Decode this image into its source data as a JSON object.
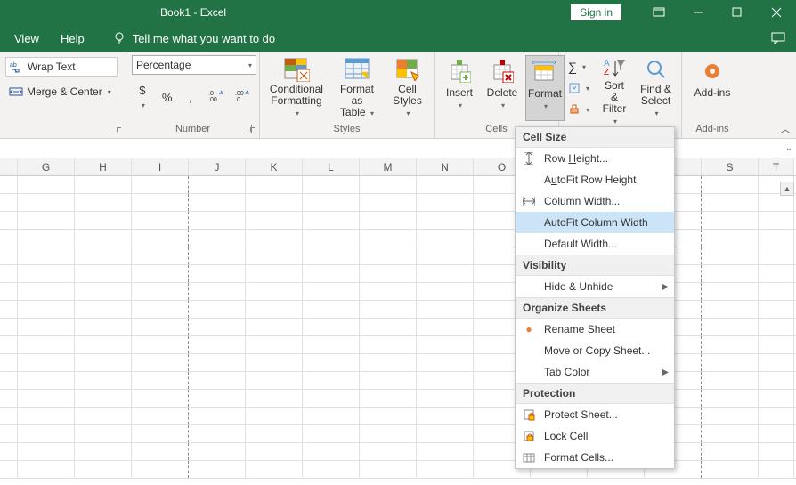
{
  "title": "Book1  -  Excel",
  "signin": "Sign in",
  "menu": {
    "view": "View",
    "help": "Help",
    "tellme": "Tell me what you want to do"
  },
  "ribbon": {
    "alignment": {
      "wrap": "Wrap Text",
      "merge": "Merge & Center"
    },
    "number": {
      "label": "Number",
      "format": "Percentage",
      "currency": "$",
      "percent": "%",
      "comma": ","
    },
    "styles": {
      "label": "Styles",
      "conditional": "Conditional\nFormatting",
      "formatas": "Format as\nTable",
      "cellstyles": "Cell\nStyles"
    },
    "cells": {
      "label": "Cells",
      "insert": "Insert",
      "delete": "Delete",
      "format": "Format"
    },
    "editing": {
      "sort": "Sort &\nFilter",
      "find": "Find &\nSelect"
    },
    "addins": {
      "label": "Add-ins",
      "btn": "Add-ins"
    }
  },
  "columns": [
    "G",
    "H",
    "I",
    "J",
    "K",
    "L",
    "M",
    "N",
    "O",
    "",
    "",
    "",
    "S",
    "T"
  ],
  "menuFormat": {
    "sec1": "Cell Size",
    "rowHeight": "Row Height...",
    "autoFitRow": "AutoFit Row Height",
    "colWidth": "Column Width...",
    "autoFitCol": "AutoFit Column Width",
    "defaultWidth": "Default Width...",
    "sec2": "Visibility",
    "hideUnhide": "Hide & Unhide",
    "sec3": "Organize Sheets",
    "rename": "Rename Sheet",
    "moveCopy": "Move or Copy Sheet...",
    "tabColor": "Tab Color",
    "sec4": "Protection",
    "protect": "Protect Sheet...",
    "lock": "Lock Cell",
    "formatCells": "Format Cells..."
  }
}
